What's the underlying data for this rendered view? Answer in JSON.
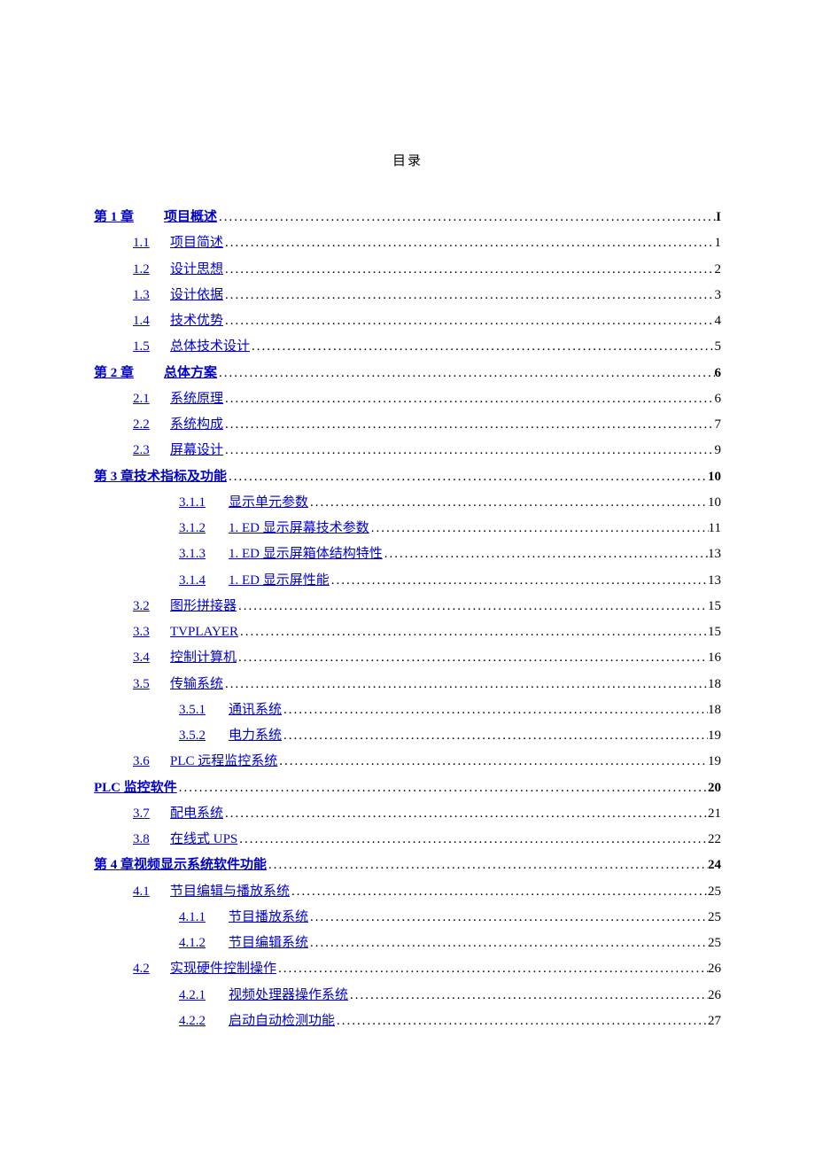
{
  "title": "目录",
  "entries": [
    {
      "level": 0,
      "bold": true,
      "num": "第 1 章",
      "label": "项目概述",
      "page": "I",
      "chapterGap": true
    },
    {
      "level": 1,
      "bold": false,
      "num": "1.1",
      "label": "项目简述",
      "page": "1"
    },
    {
      "level": 1,
      "bold": false,
      "num": "1.2",
      "label": "设计思想",
      "page": "2"
    },
    {
      "level": 1,
      "bold": false,
      "num": "1.3",
      "label": "设计依据",
      "page": "3"
    },
    {
      "level": 1,
      "bold": false,
      "num": "1.4",
      "label": "技术优势",
      "page": "4"
    },
    {
      "level": 1,
      "bold": false,
      "num": "1.5",
      "label": "总体技术设计",
      "page": "5"
    },
    {
      "level": 0,
      "bold": true,
      "num": "第 2 章",
      "label": "总体方案",
      "page": "6",
      "chapterGap": true
    },
    {
      "level": 1,
      "bold": false,
      "num": "2.1",
      "label": "系统原理",
      "page": "6"
    },
    {
      "level": 1,
      "bold": false,
      "num": "2.2",
      "label": "系统构成",
      "page": "7"
    },
    {
      "level": 1,
      "bold": false,
      "num": "2.3",
      "label": "屏幕设计",
      "page": "9"
    },
    {
      "level": 0,
      "bold": true,
      "num": "",
      "label": "第 3 章技术指标及功能",
      "page": "10"
    },
    {
      "level": 2,
      "bold": false,
      "num": "3.1.1",
      "label": "显示单元参数",
      "page": "10"
    },
    {
      "level": 2,
      "bold": false,
      "num": "3.1.2",
      "label": "1. ED 显示屏幕技术参数",
      "page": "11"
    },
    {
      "level": 2,
      "bold": false,
      "num": "3.1.3",
      "label": "1. ED 显示屏箱体结构特性",
      "page": "13"
    },
    {
      "level": 2,
      "bold": false,
      "num": "3.1.4",
      "label": "1. ED 显示屏性能",
      "page": "13"
    },
    {
      "level": 1,
      "bold": false,
      "num": "3.2",
      "label": "图形拼接器",
      "page": "15"
    },
    {
      "level": 1,
      "bold": false,
      "num": "3.3",
      "label": "TVPLAYER",
      "page": "15"
    },
    {
      "level": 1,
      "bold": false,
      "num": "3.4",
      "label": "控制计算机",
      "page": "16"
    },
    {
      "level": 1,
      "bold": false,
      "num": "3.5",
      "label": "传输系统",
      "page": "18"
    },
    {
      "level": 2,
      "bold": false,
      "num": "3.5.1",
      "label": "通讯系统",
      "page": "18"
    },
    {
      "level": 2,
      "bold": false,
      "num": "3.5.2",
      "label": "电力系统",
      "page": "19"
    },
    {
      "level": 1,
      "bold": false,
      "num": "3.6",
      "label": "PLC 远程监控系统",
      "page": "19"
    },
    {
      "level": 0,
      "bold": true,
      "num": "",
      "label": "PLC 监控软件",
      "page": "20"
    },
    {
      "level": 1,
      "bold": false,
      "num": "3.7",
      "label": "配电系统",
      "page": "21"
    },
    {
      "level": 1,
      "bold": false,
      "num": "3.8",
      "label": "在线式 UPS",
      "page": "22"
    },
    {
      "level": 0,
      "bold": true,
      "num": "",
      "label": "第 4 章视频显示系统软件功能",
      "page": "24"
    },
    {
      "level": 1,
      "bold": false,
      "num": "4.1",
      "label": "节目编辑与播放系统",
      "page": "25"
    },
    {
      "level": 2,
      "bold": false,
      "num": "4.1.1",
      "label": "节目播放系统",
      "page": "25"
    },
    {
      "level": 2,
      "bold": false,
      "num": "4.1.2",
      "label": "节目编辑系统",
      "page": "25"
    },
    {
      "level": 1,
      "bold": false,
      "num": "4.2",
      "label": "实现硬件控制操作",
      "page": "26"
    },
    {
      "level": 2,
      "bold": false,
      "num": "4.2.1",
      "label": "视频处理器操作系统",
      "page": "26"
    },
    {
      "level": 2,
      "bold": false,
      "num": "4.2.2",
      "label": "启动自动检测功能",
      "page": "27"
    }
  ]
}
